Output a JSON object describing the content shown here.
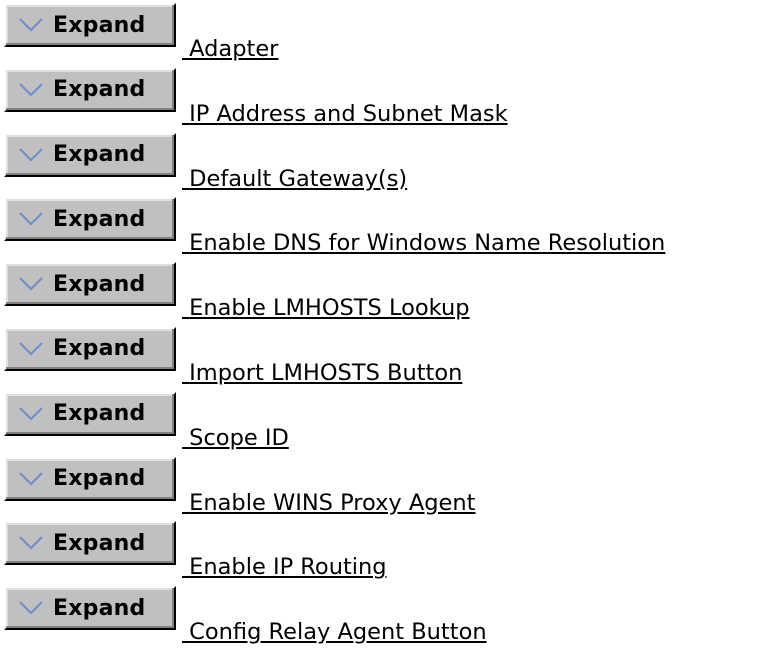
{
  "expand_label": "Expand",
  "items": [
    {
      "label": "Adapter"
    },
    {
      "label": "IP Address and Subnet Mask"
    },
    {
      "label": "Default Gateway(s)"
    },
    {
      "label": "Enable DNS for Windows Name Resolution"
    },
    {
      "label": "Enable LMHOSTS Lookup"
    },
    {
      "label": "Import LMHOSTS Button"
    },
    {
      "label": "Scope ID"
    },
    {
      "label": "Enable WINS Proxy Agent"
    },
    {
      "label": "Enable IP Routing"
    },
    {
      "label": "Config Relay Agent Button"
    }
  ]
}
